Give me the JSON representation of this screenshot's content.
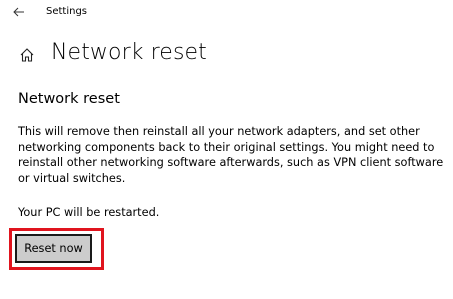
{
  "window": {
    "title": "Settings",
    "back_icon": "arrow-left-icon"
  },
  "header": {
    "icon": "home-icon",
    "title": "Network reset"
  },
  "section": {
    "heading": "Network reset",
    "description": "This will remove then reinstall all your network adapters, and set other networking components back to their original settings. You might need to reinstall other networking software afterwards, such as VPN client software or virtual switches.",
    "restart_note": "Your PC will be restarted."
  },
  "actions": {
    "reset_label": "Reset now"
  },
  "colors": {
    "highlight": "#e0141e",
    "button_bg": "#cccccc",
    "button_border": "#1a1a1a"
  }
}
